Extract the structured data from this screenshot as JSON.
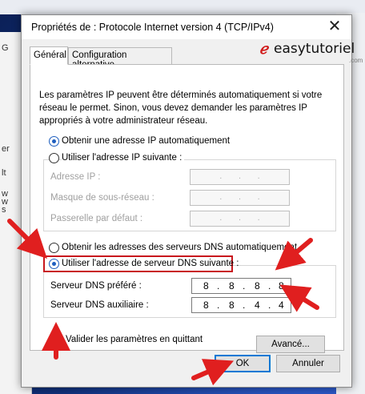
{
  "window": {
    "title": "Propriétés de : Protocole Internet version 4 (TCP/IPv4)"
  },
  "tabs": [
    {
      "label": "Général"
    },
    {
      "label": "Configuration alternative"
    }
  ],
  "watermark": {
    "brand": "easytutoriel",
    "suffix": ".com"
  },
  "intro_text": "Les paramètres IP peuvent être déterminés automatiquement si votre réseau le permet. Sinon, vous devez demander les paramètres IP appropriés à votre administrateur réseau.",
  "ip": {
    "auto_label": "Obtenir une adresse IP automatiquement",
    "manual_label": "Utiliser l'adresse IP suivante :",
    "selected": "auto",
    "fields": [
      {
        "label": "Adresse IP :"
      },
      {
        "label": "Masque de sous-réseau :"
      },
      {
        "label": "Passerelle par défaut :"
      }
    ]
  },
  "dns": {
    "auto_label": "Obtenir les adresses des serveurs DNS automatiquement",
    "manual_label": "Utiliser l'adresse de serveur DNS suivante :",
    "selected": "manual",
    "preferred": {
      "label": "Serveur DNS préféré :",
      "octets": [
        "8",
        "8",
        "8",
        "8"
      ]
    },
    "alternate": {
      "label": "Serveur DNS auxiliaire :",
      "octets": [
        "8",
        "8",
        "4",
        "4"
      ]
    }
  },
  "validate": {
    "label": "Valider les paramètres en quittant",
    "checked": true
  },
  "buttons": {
    "advanced": "Avancé...",
    "ok": "OK",
    "cancel": "Annuler"
  },
  "background": {
    "fragments": [
      "G",
      "er",
      "lt",
      "w",
      "w",
      "s"
    ]
  },
  "colors": {
    "accent": "#1f5fbf",
    "highlight": "#c8161d",
    "default_button": "#0078d4"
  }
}
